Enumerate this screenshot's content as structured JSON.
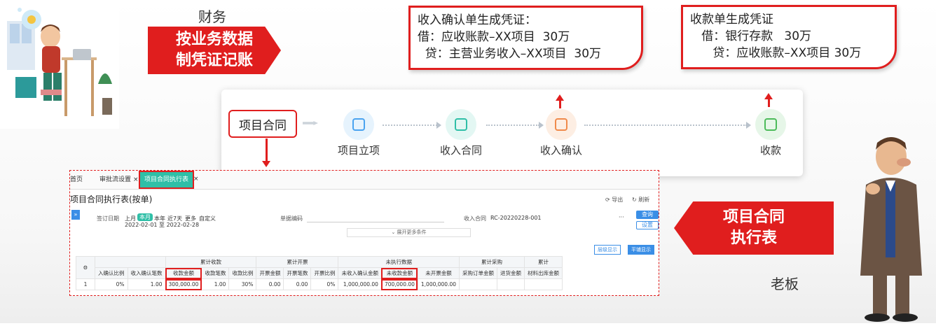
{
  "labels": {
    "finance": "财务",
    "boss": "老板"
  },
  "left_banner": {
    "line1": "按业务数据",
    "line2": "制凭证记账"
  },
  "right_banner": {
    "line1": "项目合同",
    "line2": "执行表"
  },
  "note_income": {
    "line1": "收入确认单生成凭证：",
    "line2": "借：应收账款–XX项目  30万",
    "line3": "  贷：主营业务收入–XX项目  30万"
  },
  "note_receipt": {
    "line1": "收款单生成凭证",
    "line2": "   借：银行存款   30万",
    "line3": "      贷：应收账款–XX项目 30万"
  },
  "flow": {
    "start": "项目合同",
    "steps": [
      {
        "label": "项目立项",
        "icon": "project-setup-icon",
        "color": "#4aa3f0",
        "bg": "#e6f3fd"
      },
      {
        "label": "收入合同",
        "icon": "income-contract-icon",
        "color": "#2fbfa7",
        "bg": "#e3f7f3"
      },
      {
        "label": "收入确认",
        "icon": "income-confirm-icon",
        "color": "#f08a4b",
        "bg": "#fdeee3"
      },
      {
        "label": "收款",
        "icon": "receipt-icon",
        "color": "#4cbb5a",
        "bg": "#e6f6e8"
      }
    ]
  },
  "app": {
    "tabs": [
      {
        "label": "首页",
        "closable": false
      },
      {
        "label": "审批流设置",
        "closable": true
      },
      {
        "label": "项目合同执行表",
        "closable": true,
        "active": true
      }
    ],
    "title": "项目合同执行表(按单)",
    "toolbar": {
      "export": "导出",
      "refresh": "刷新"
    },
    "filters": {
      "sign_date_label": "签订日期",
      "quick_dates": [
        "上月",
        "本月",
        "本年",
        "近7天",
        "更多",
        "自定义"
      ],
      "active_quick_date": "本月",
      "date_range": "2022-02-01 至 2022-02-28",
      "doc_no_label": "单据编码",
      "income_contract_label": "收入合同",
      "income_contract_value": "RC-20220228-001",
      "more_filters": "展开更多条件",
      "ellipsis": "···"
    },
    "buttons": {
      "query": "查询",
      "settings": "设置",
      "hierarchy": "层级显示",
      "flat": "平铺显示"
    },
    "group_headers": [
      "累计收款",
      "累计开票",
      "未执行数据",
      "累计采购",
      "累计"
    ],
    "columns": [
      "入确认比例",
      "收入确认笔数",
      "收款金额",
      "收款笔数",
      "收款比例",
      "开票金额",
      "开票笔数",
      "开票比例",
      "未收入确认金额",
      "未收款金额",
      "未开票金额",
      "采购订单金额",
      "进货金额",
      "材料出库金额"
    ],
    "rows": [
      {
        "index": "1",
        "cells": [
          "0%",
          "1.00",
          "300,000.00",
          "1.00",
          "30%",
          "0.00",
          "0.00",
          "0%",
          "1,000,000.00",
          "700,000.00",
          "1,000,000.00",
          "",
          "",
          ""
        ]
      }
    ]
  }
}
